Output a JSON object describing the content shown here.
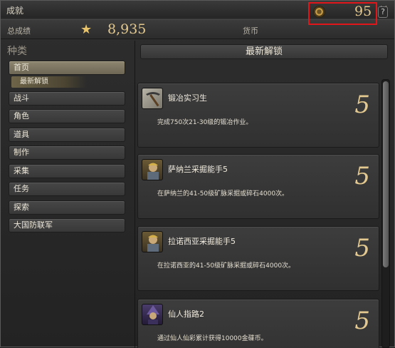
{
  "window": {
    "title": "成就"
  },
  "status": {
    "total_label": "总成绩",
    "total_score": "8,935",
    "currency_label": "货币",
    "currency_value": "95",
    "help": "?"
  },
  "sidebar": {
    "heading": "种类",
    "items": [
      {
        "label": "首页"
      },
      {
        "label": "战斗"
      },
      {
        "label": "角色"
      },
      {
        "label": "道具"
      },
      {
        "label": "制作"
      },
      {
        "label": "采集"
      },
      {
        "label": "任务"
      },
      {
        "label": "探索"
      },
      {
        "label": "大国防联军"
      }
    ],
    "subitem": "最新解锁"
  },
  "main": {
    "header": "最新解锁",
    "cards": [
      {
        "name": "锻冶实习生",
        "desc": "完成750次21-30级的锻冶作业。",
        "points": "5",
        "icon": "pickaxe-icon"
      },
      {
        "name": "萨纳兰采掘能手5",
        "desc": "在萨纳兰的41-50级矿脉采掘或碎石4000次。",
        "points": "5",
        "icon": "miner-icon"
      },
      {
        "name": "拉诺西亚采掘能手5",
        "desc": "在拉诺西亚的41-50级矿脉采掘或碎石4000次。",
        "points": "5",
        "icon": "miner-icon"
      },
      {
        "name": "仙人指路2",
        "desc": "通过仙人仙彩累计获得10000金碟币。",
        "points": "5",
        "icon": "mage-icon"
      }
    ]
  },
  "colors": {
    "gold": "#e3c98f",
    "highlight_box": "#e0161a",
    "active_category": "#8d856f"
  }
}
